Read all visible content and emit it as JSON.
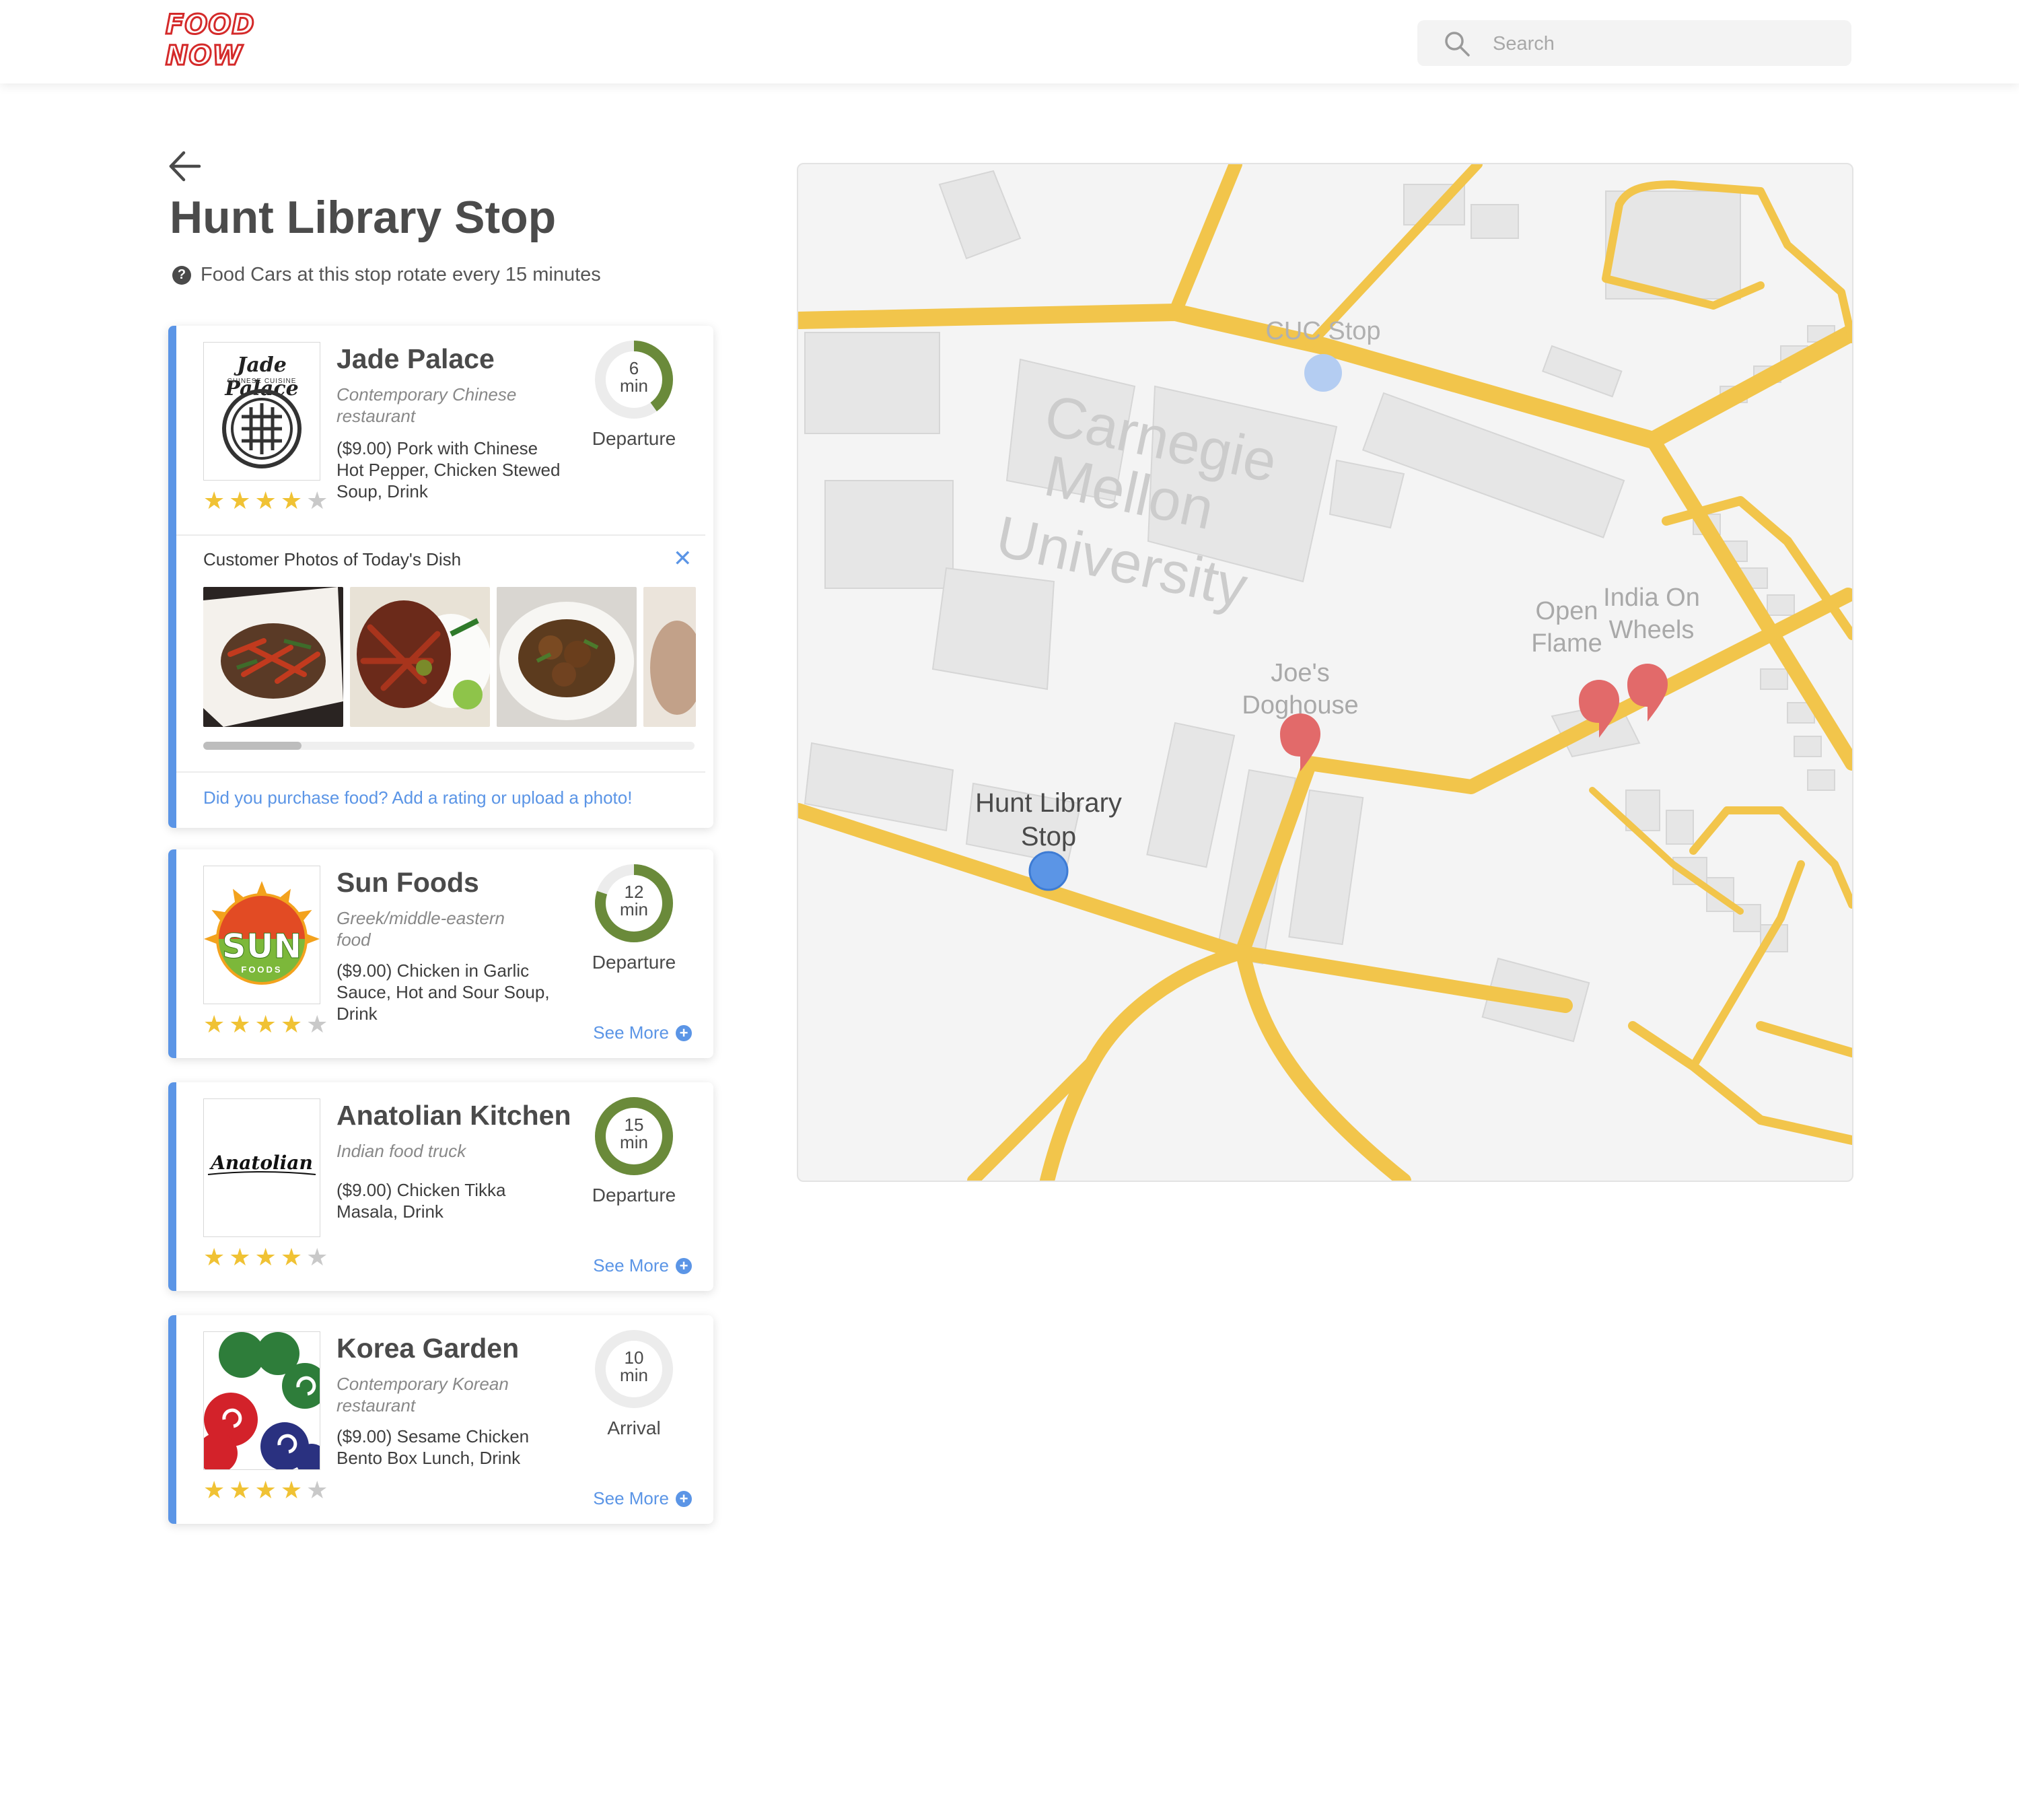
{
  "header": {
    "logo_line1": "FOOD",
    "logo_line2": "NOW",
    "search_placeholder": "Search"
  },
  "page": {
    "title": "Hunt Library Stop",
    "subtitle": "Food Cars at this stop rotate every 15 minutes"
  },
  "colors": {
    "accent": "#5b95e6",
    "logo": "#d42a2a",
    "star": "#f0c234",
    "ring": "#6a8a3a",
    "road": "#f2c54b",
    "marker": "#e26a6a"
  },
  "cards": [
    {
      "name": "Jade Palace",
      "description": "Contemporary Chinese restaurant",
      "meal": "($9.00) Pork with Chinese Hot Pepper, Chicken Stewed Soup, Drink",
      "time_value": "6",
      "time_unit": "min",
      "status": "Departure",
      "rating": 4,
      "max_rating": 5,
      "remaining_fraction": 0.4,
      "logo_text": "Jade Palace",
      "logo_sub": "CHINESE CUISINE",
      "photos_title": "Customer Photos of Today's Dish",
      "rate_link": "Did you purchase food? Add a rating or upload a photo!"
    },
    {
      "name": "Sun Foods",
      "description": "Greek/middle-eastern food",
      "meal": "($9.00) Chicken in Garlic Sauce, Hot and Sour Soup, Drink",
      "time_value": "12",
      "time_unit": "min",
      "status": "Departure",
      "rating": 4,
      "max_rating": 5,
      "remaining_fraction": 0.8,
      "logo_text": "SUN",
      "logo_sub": "FOODS",
      "see_more": "See More"
    },
    {
      "name": "Anatolian Kitchen",
      "description": "Indian food truck",
      "meal": "($9.00) Chicken Tikka Masala, Drink",
      "time_value": "15",
      "time_unit": "min",
      "status": "Departure",
      "rating": 4,
      "max_rating": 5,
      "remaining_fraction": 1.0,
      "logo_text": "Anatolian",
      "see_more": "See More"
    },
    {
      "name": "Korea Garden",
      "description": "Contemporary Korean restaurant",
      "meal": "($9.00) Sesame Chicken Bento Box Lunch, Drink",
      "time_value": "10",
      "time_unit": "min",
      "status": "Arrival",
      "rating": 4,
      "max_rating": 5,
      "remaining_fraction": 0.0,
      "see_more": "See More"
    }
  ],
  "map": {
    "campus_label_1": "Carnegie",
    "campus_label_2": "Mellon",
    "campus_label_3": "University",
    "stops": [
      {
        "label": "CUC Stop",
        "active": false
      },
      {
        "label_1": "Hunt Library",
        "label_2": "Stop",
        "active": true
      }
    ],
    "vendors": [
      {
        "label_1": "Joe's",
        "label_2": "Doghouse"
      },
      {
        "label_1": "Open",
        "label_2": "Flame"
      },
      {
        "label_1": "India On",
        "label_2": "Wheels"
      }
    ]
  }
}
